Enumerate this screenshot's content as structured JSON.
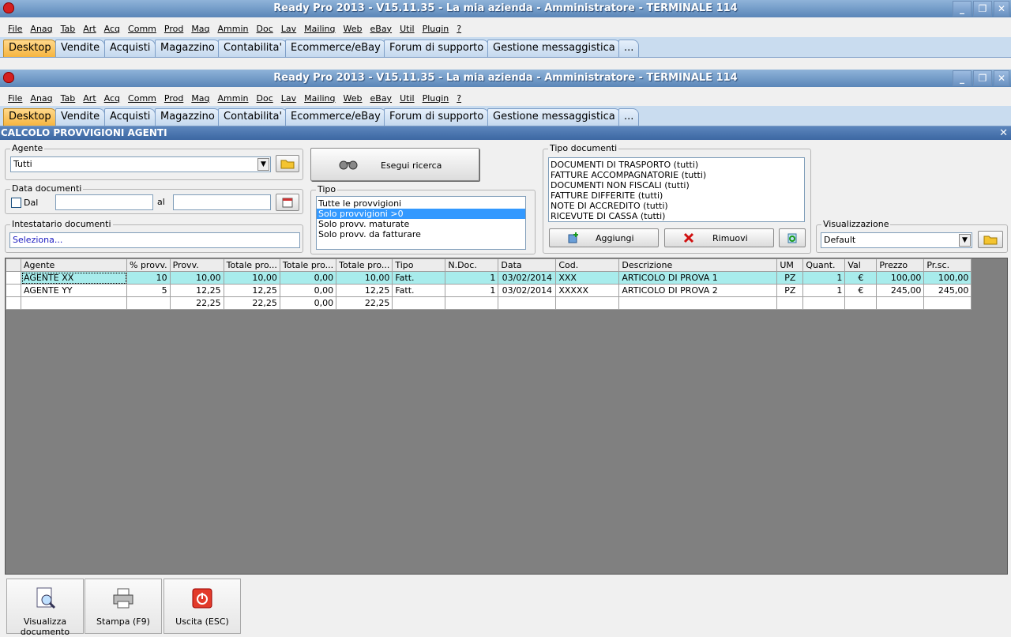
{
  "window": {
    "title": "Ready Pro 2013 - V15.11.35 - La mia azienda - Amministratore - TERMINALE 114",
    "btn_min": "_",
    "btn_max": "❐",
    "btn_close": "✕"
  },
  "menu": [
    "File",
    "Anag",
    "Tab",
    "Art",
    "Acq",
    "Comm",
    "Prod",
    "Mag",
    "Ammin",
    "Doc",
    "Lav",
    "Mailing",
    "Web",
    "eBay",
    "Util",
    "Plugin",
    "?"
  ],
  "tabs": [
    "Desktop",
    "Vendite",
    "Acquisti",
    "Magazzino",
    "Contabilita'",
    "Ecommerce/eBay",
    "Forum di supporto",
    "Gestione messaggistica",
    "..."
  ],
  "panel": {
    "title": "CALCOLO PROVVIGIONI AGENTI",
    "close": "✕"
  },
  "agente": {
    "label": "Agente",
    "value": "Tutti"
  },
  "data_doc": {
    "label": "Data documenti",
    "dal": "Dal",
    "al": "al"
  },
  "intestatario": {
    "label": "Intestatario documenti",
    "value": "Seleziona..."
  },
  "search_btn": "Esegui ricerca",
  "tipo": {
    "label": "Tipo",
    "options": [
      "Tutte le provvigioni",
      "Solo provvigioni >0",
      "Solo provv. maturate",
      "Solo provv. da fatturare"
    ]
  },
  "tipo_documenti": {
    "label": "Tipo documenti",
    "items": [
      "DOCUMENTI DI TRASPORTO (tutti)",
      "FATTURE ACCOMPAGNATORIE (tutti)",
      "DOCUMENTI NON FISCALI (tutti)",
      "FATTURE DIFFERITE (tutti)",
      "NOTE DI ACCREDITO (tutti)",
      "RICEVUTE DI CASSA (tutti)"
    ],
    "add": "Aggiungi",
    "remove": "Rimuovi"
  },
  "visualizzazione": {
    "label": "Visualizzazione",
    "value": "Default"
  },
  "grid": {
    "columns": [
      "Agente",
      "% provv.",
      "Provv.",
      "Totale pro...",
      "Totale pro...",
      "Totale pro...",
      "Tipo",
      "N.Doc.",
      "Data",
      "Cod.",
      "Descrizione",
      "UM",
      "Quant.",
      "Val",
      "Prezzo",
      "Pr.sc."
    ],
    "rows": [
      [
        "AGENTE XX",
        "10",
        "10,00",
        "10,00",
        "0,00",
        "10,00",
        "Fatt.",
        "1",
        "03/02/2014",
        "XXX",
        "ARTICOLO DI PROVA 1",
        "PZ",
        "1",
        "€",
        "100,00",
        "100,00"
      ],
      [
        "AGENTE YY",
        "5",
        "12,25",
        "12,25",
        "0,00",
        "12,25",
        "Fatt.",
        "1",
        "03/02/2014",
        "XXXXX",
        "ARTICOLO DI PROVA 2",
        "PZ",
        "1",
        "€",
        "245,00",
        "245,00"
      ],
      [
        "",
        "",
        "22,25",
        "22,25",
        "0,00",
        "22,25",
        "",
        "",
        "",
        "",
        "",
        "",
        "",
        "",
        "",
        ""
      ]
    ]
  },
  "bottom": {
    "view_doc": "Visualizza documento",
    "print": "Stampa (F9)",
    "exit": "Uscita (ESC)"
  }
}
